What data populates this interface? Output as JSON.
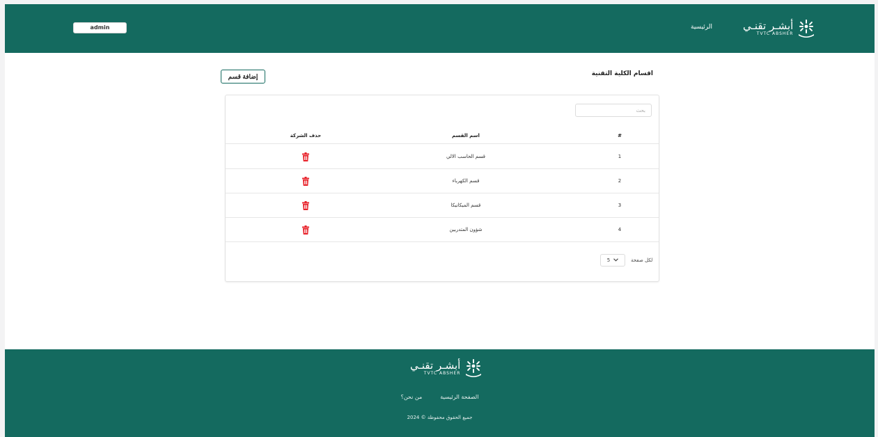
{
  "header": {
    "user_button": "admin",
    "nav_home": "الرئيسية",
    "logo_ar": "أبشـر تقنـي",
    "logo_en": "TVTC ABSHER"
  },
  "main": {
    "title": "اقسام الكلية التقنية",
    "add_button": "إضافة قسم"
  },
  "table": {
    "search_placeholder": "بحث",
    "columns": {
      "number": "#",
      "name": "اسم القسم",
      "delete": "حذف الشركة"
    },
    "rows": [
      {
        "number": "1",
        "name": "قسم الحاسب الالي"
      },
      {
        "number": "2",
        "name": "قسم الكهرباء"
      },
      {
        "number": "3",
        "name": "قسم الميكانيكا"
      },
      {
        "number": "4",
        "name": "شؤون المتدربين"
      }
    ],
    "per_page_label": "لكل صفحة",
    "per_page_value": "5"
  },
  "footer": {
    "logo_ar": "أبشـر تقنـي",
    "logo_en": "TVTC ABSHER",
    "links": {
      "home": "الصفحة الرئيسية",
      "about": "من نحن؟"
    },
    "copyright": "جميع الحقوق محفوظة © 2024"
  },
  "colors": {
    "brand": "#146a5f",
    "danger": "#e8232b",
    "background": "#f3f3f4"
  }
}
